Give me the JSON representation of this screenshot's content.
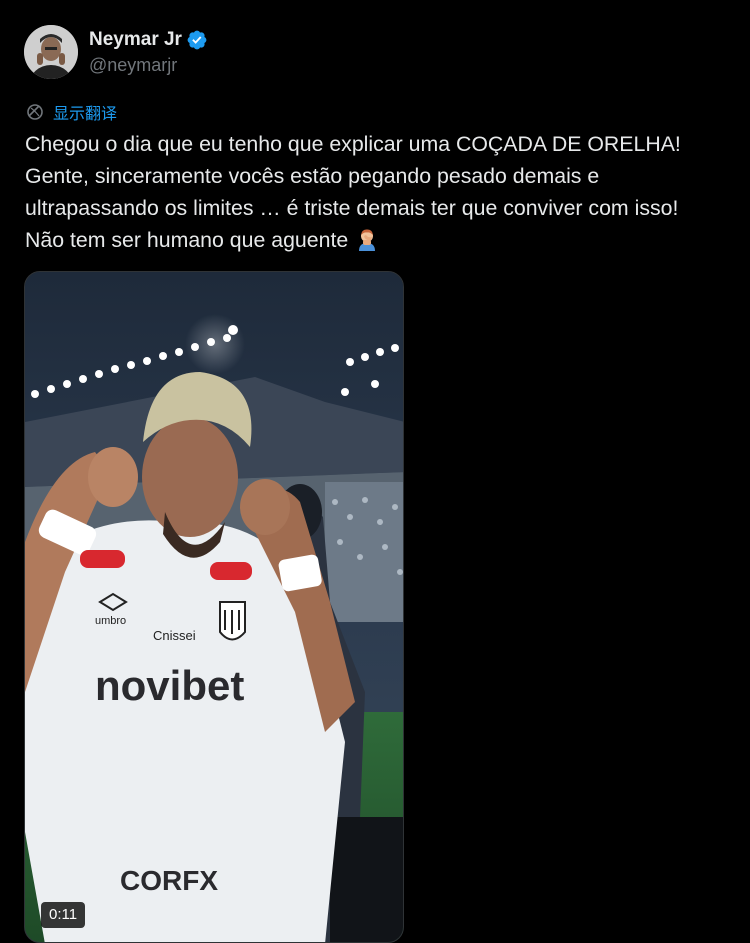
{
  "author": {
    "display_name": "Neymar Jr",
    "handle": "@neymarjr",
    "verified_icon": "verified-badge-icon",
    "verified_color": "#1d9bf0"
  },
  "translate": {
    "label": "显示翻译",
    "icon": "globe-icon",
    "color": "#1d9bf0"
  },
  "tweet": {
    "lines": [
      "Chegou o dia que eu tenho que explicar uma COÇADA DE ORELHA!",
      "Gente, sinceramente vocês estão pegando pesado demais e",
      "ultrapassando os limites … é triste demais ter que conviver com isso!",
      "Não tem ser humano que aguente"
    ],
    "emoji": "man-facepalming-emoji"
  },
  "media": {
    "type": "video",
    "duration": "0:11",
    "jersey_sponsor": "novibet"
  },
  "colors": {
    "background": "#000000",
    "text": "#e7e9ea",
    "secondary": "#71767b",
    "accent": "#1d9bf0"
  }
}
